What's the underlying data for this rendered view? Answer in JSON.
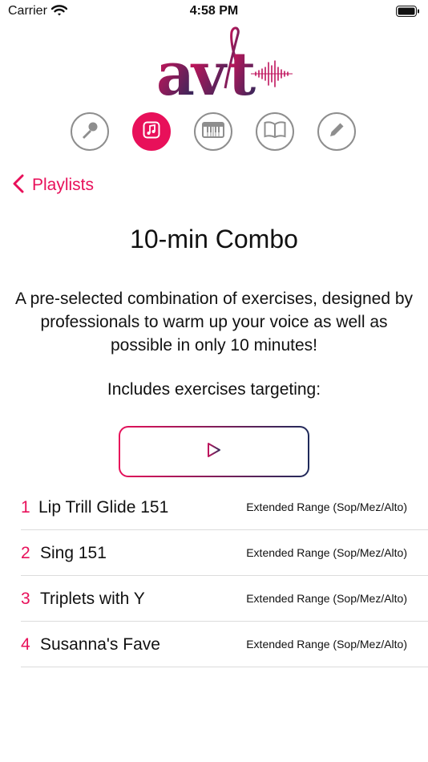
{
  "status": {
    "carrier": "Carrier",
    "time": "4:58 PM"
  },
  "brand": {
    "logo_text": "avt",
    "accent": "#e8105a",
    "dark": "#1e2a5a"
  },
  "tabs": [
    {
      "icon": "microphone-icon",
      "active": false
    },
    {
      "icon": "music-note-icon",
      "active": true
    },
    {
      "icon": "piano-keys-icon",
      "active": false
    },
    {
      "icon": "book-icon",
      "active": false
    },
    {
      "icon": "pencil-icon",
      "active": false
    }
  ],
  "nav": {
    "back_label": "Playlists"
  },
  "playlist": {
    "title": "10-min Combo",
    "description": "A pre-selected combination of exercises, designed by professionals to warm up your voice as well as possible in only 10 minutes!",
    "includes_label": "Includes exercises targeting:"
  },
  "exercises": [
    {
      "number": "1",
      "name": "Lip Trill Glide 151",
      "range": "Extended Range (Sop/Mez/Alto)"
    },
    {
      "number": "2",
      "name": "Sing 151",
      "range": "Extended Range (Sop/Mez/Alto)"
    },
    {
      "number": "3",
      "name": "Triplets with Y",
      "range": "Extended Range (Sop/Mez/Alto)"
    },
    {
      "number": "4",
      "name": "Susanna's Fave",
      "range": "Extended Range (Sop/Mez/Alto)"
    }
  ]
}
